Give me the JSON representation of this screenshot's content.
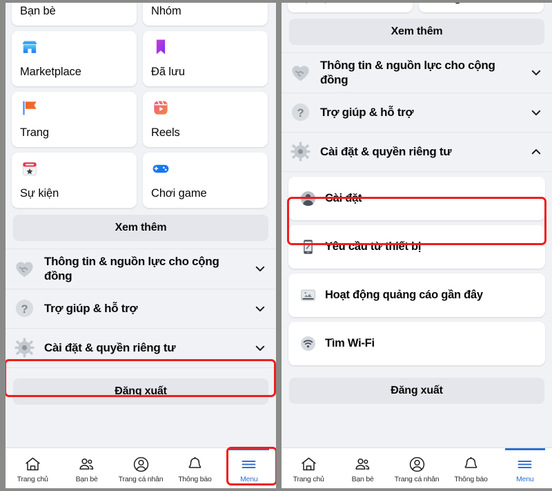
{
  "app": {
    "accent_blue": "#2f6fd0",
    "highlight_red": "#ee1d1d",
    "bg_gray": "#f0f2f5",
    "button_gray": "#e4e6eb"
  },
  "left_panel": {
    "shortcut_cards": [
      {
        "label": "Bạn bè",
        "icon": "friends-icon"
      },
      {
        "label": "Nhóm",
        "icon": "groups-icon"
      },
      {
        "label": "Marketplace",
        "icon": "marketplace-icon"
      },
      {
        "label": "Đã lưu",
        "icon": "saved-bookmark-icon"
      },
      {
        "label": "Trang",
        "icon": "pages-flag-icon"
      },
      {
        "label": "Reels",
        "icon": "reels-icon"
      },
      {
        "label": "Sự kiện",
        "icon": "events-calendar-icon"
      },
      {
        "label": "Chơi game",
        "icon": "gaming-controller-icon"
      }
    ],
    "see_more_label": "Xem thêm",
    "sections": [
      {
        "label": "Thông tin & nguồn lực cho cộng đồng",
        "icon": "handshake-heart-icon",
        "chevron": "chevron-down-icon"
      },
      {
        "label": "Trợ giúp & hỗ trợ",
        "icon": "question-mark-icon",
        "chevron": "chevron-down-icon"
      },
      {
        "label": "Cài đặt & quyền riêng tư",
        "icon": "gear-icon",
        "chevron": "chevron-down-icon"
      }
    ],
    "logout_label": "Đăng xuất",
    "nav": [
      {
        "label": "Trang chủ",
        "icon": "home-icon",
        "active": false
      },
      {
        "label": "Bạn bè",
        "icon": "friends-icon",
        "active": false
      },
      {
        "label": "Trang cá nhân",
        "icon": "profile-icon",
        "active": false
      },
      {
        "label": "Thông báo",
        "icon": "bell-icon",
        "active": false
      },
      {
        "label": "Menu",
        "icon": "hamburger-menu-icon",
        "active": true
      }
    ]
  },
  "right_panel": {
    "partial_cards": [
      {
        "label": "Sự kiện",
        "icon": "events-calendar-icon"
      },
      {
        "label": "Chơi game",
        "icon": "gaming-controller-icon"
      }
    ],
    "see_more_label": "Xem thêm",
    "sections": [
      {
        "label": "Thông tin & nguồn lực cho cộng đồng",
        "icon": "handshake-heart-icon",
        "chevron": "chevron-down-icon"
      },
      {
        "label": "Trợ giúp & hỗ trợ",
        "icon": "question-mark-icon",
        "chevron": "chevron-down-icon"
      },
      {
        "label": "Cài đặt & quyền riêng tư",
        "icon": "gear-icon",
        "chevron": "chevron-up-icon"
      }
    ],
    "sub_items": [
      {
        "label": "Cài đặt",
        "icon": "account-avatar-icon",
        "highlighted": true
      },
      {
        "label": "Yêu cầu từ thiết bị",
        "icon": "device-request-icon",
        "highlighted": false
      },
      {
        "label": "Hoạt động quảng cáo gần đây",
        "icon": "ad-activity-icon",
        "highlighted": false
      },
      {
        "label": "Tìm Wi-Fi",
        "icon": "wifi-icon",
        "highlighted": false
      }
    ],
    "logout_label": "Đăng xuất",
    "nav": [
      {
        "label": "Trang chủ",
        "icon": "home-icon",
        "active": false
      },
      {
        "label": "Bạn bè",
        "icon": "friends-icon",
        "active": false
      },
      {
        "label": "Trang cá nhân",
        "icon": "profile-icon",
        "active": false
      },
      {
        "label": "Thông báo",
        "icon": "bell-icon",
        "active": false
      },
      {
        "label": "Menu",
        "icon": "hamburger-menu-icon",
        "active": true
      }
    ]
  }
}
